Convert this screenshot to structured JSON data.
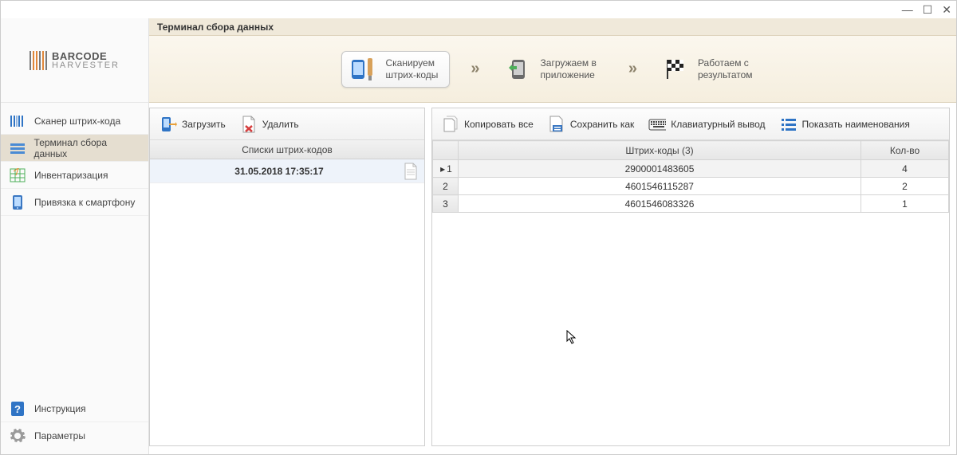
{
  "window": {
    "minimize": "—",
    "maximize": "☐",
    "close": "✕"
  },
  "logo": {
    "l1": "BARCODE",
    "l2": "HARVESTER"
  },
  "sidebar": {
    "items": [
      {
        "label": "Сканер штрих-кода"
      },
      {
        "label": "Терминал сбора данных"
      },
      {
        "label": "Инвентаризация"
      },
      {
        "label": "Привязка к смартфону"
      }
    ],
    "bottom": [
      {
        "label": "Инструкция"
      },
      {
        "label": "Параметры"
      }
    ]
  },
  "page": {
    "title": "Терминал сбора данных"
  },
  "steps": {
    "s1a": "Сканируем",
    "s1b": "штрих-коды",
    "s2a": "Загружаем в",
    "s2b": "приложение",
    "s3a": "Работаем с",
    "s3b": "результатом"
  },
  "leftToolbar": {
    "load": "Загрузить",
    "delete": "Удалить"
  },
  "leftHeader": "Списки штрих-кодов",
  "leftRows": [
    {
      "label": "31.05.2018 17:35:17"
    }
  ],
  "rightToolbar": {
    "copy": "Копировать все",
    "save": "Сохранить как",
    "keyboard": "Клавиатурный вывод",
    "shownames": "Показать наименования"
  },
  "rightHeaders": {
    "code": "Штрих-коды (3)",
    "qty": "Кол-во"
  },
  "rightRows": [
    {
      "n": "1",
      "code": "2900001483605",
      "qty": "4"
    },
    {
      "n": "2",
      "code": "4601546115287",
      "qty": "2"
    },
    {
      "n": "3",
      "code": "4601546083326",
      "qty": "1"
    }
  ]
}
